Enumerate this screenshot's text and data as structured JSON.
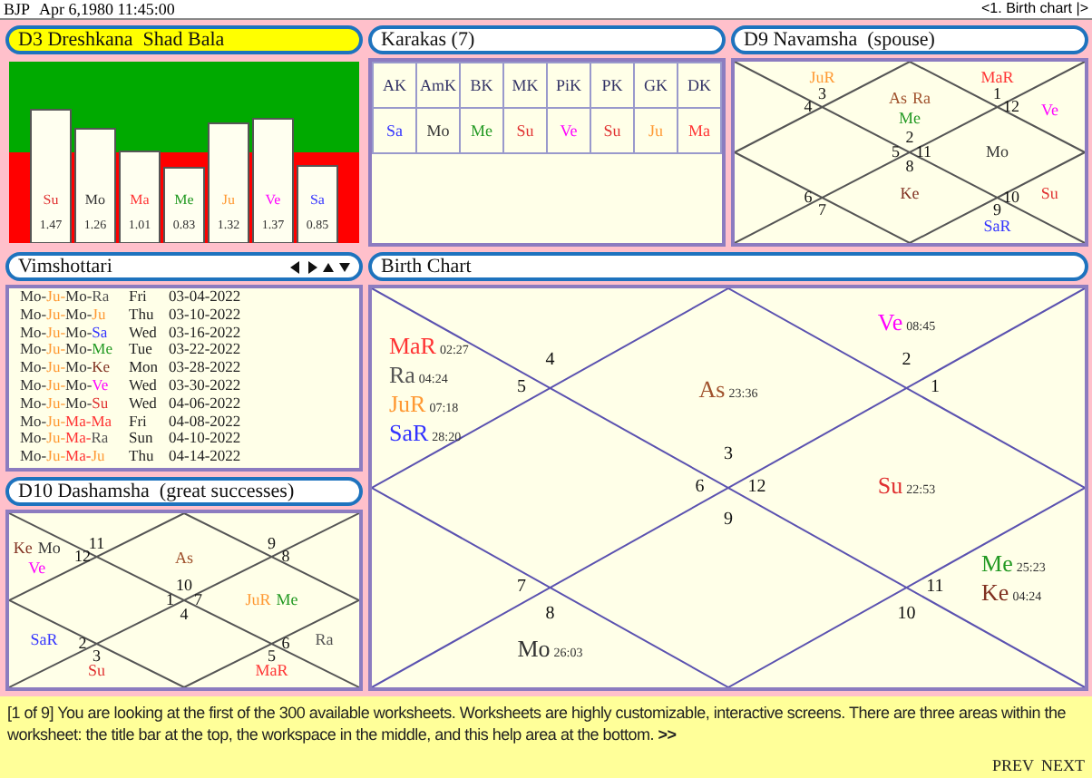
{
  "title_bar": {
    "chart_name": "BJP",
    "datetime": "Apr 6,1980 11:45:00",
    "worksheet": "<1. Birth chart |>"
  },
  "shad_bala": {
    "title": "D3 Dreshkana  Shad Bala",
    "bars": [
      {
        "planet": "Su",
        "color": "#e03030",
        "value": "1.47"
      },
      {
        "planet": "Mo",
        "color": "#333333",
        "value": "1.26"
      },
      {
        "planet": "Ma",
        "color": "#ff3333",
        "value": "1.01"
      },
      {
        "planet": "Me",
        "color": "#229922",
        "value": "0.83"
      },
      {
        "planet": "Ju",
        "color": "#ff9933",
        "value": "1.32"
      },
      {
        "planet": "Ve",
        "color": "#ff00ff",
        "value": "1.37"
      },
      {
        "planet": "Sa",
        "color": "#3333ff",
        "value": "0.85"
      }
    ]
  },
  "karakas": {
    "title": "Karakas (7)",
    "columns": [
      "AK",
      "AmK",
      "BK",
      "MK",
      "PiK",
      "PK",
      "GK",
      "DK"
    ],
    "values": [
      {
        "text": "Sa",
        "color": "#3333ff"
      },
      {
        "text": "Mo",
        "color": "#333333"
      },
      {
        "text": "Me",
        "color": "#229922"
      },
      {
        "text": "Su",
        "color": "#e03030"
      },
      {
        "text": "Ve",
        "color": "#ff00ff"
      },
      {
        "text": "Su",
        "color": "#e03030"
      },
      {
        "text": "Ju",
        "color": "#ff9933"
      },
      {
        "text": "Ma",
        "color": "#ff3333"
      }
    ]
  },
  "navamsha": {
    "title": "D9 Navamsha  (spouse)",
    "houses": [
      {
        "number": "2",
        "lines": [
          [
            {
              "name": "As",
              "color": "#a0522d"
            },
            {
              "name": "Ra",
              "color": "#a0522d"
            }
          ],
          [
            {
              "name": "Me",
              "color": "#229922"
            }
          ]
        ]
      },
      {
        "number": "3",
        "lines": [
          [
            {
              "name": "JuR",
              "color": "#ff9933"
            }
          ]
        ]
      },
      {
        "number": "4"
      },
      {
        "number": "5"
      },
      {
        "number": "6"
      },
      {
        "number": "7"
      },
      {
        "number": "8",
        "lines": [
          [
            {
              "name": "Ke",
              "color": "#803020"
            }
          ]
        ]
      },
      {
        "number": "9",
        "lines": [
          [
            {
              "name": "SaR",
              "color": "#3333ff"
            }
          ]
        ]
      },
      {
        "number": "10",
        "lines": [
          [
            {
              "name": "Su",
              "color": "#e03030"
            }
          ]
        ]
      },
      {
        "number": "11",
        "lines": [
          [
            {
              "name": "Mo",
              "color": "#333333"
            }
          ]
        ]
      },
      {
        "number": "12",
        "lines": [
          [
            {
              "name": "Ve",
              "color": "#ff00ff"
            }
          ]
        ]
      },
      {
        "number": "1",
        "lines": [
          [
            {
              "name": "MaR",
              "color": "#ff3333"
            }
          ]
        ]
      }
    ]
  },
  "vimshottari": {
    "title": "Vimshottari",
    "rows": [
      {
        "parts": [
          {
            "text": "Mo-",
            "color": "#333333"
          },
          {
            "text": "Ju-",
            "color": "#ff9933"
          },
          {
            "text": "Mo-",
            "color": "#333333"
          },
          {
            "text": "Ra",
            "color": "#555555"
          }
        ],
        "day": "Fri",
        "date": "03-04-2022"
      },
      {
        "parts": [
          {
            "text": "Mo-",
            "color": "#333333"
          },
          {
            "text": "Ju-",
            "color": "#ff9933"
          },
          {
            "text": "Mo-",
            "color": "#333333"
          },
          {
            "text": "Ju",
            "color": "#ff9933"
          }
        ],
        "day": "Thu",
        "date": "03-10-2022"
      },
      {
        "parts": [
          {
            "text": "Mo-",
            "color": "#333333"
          },
          {
            "text": "Ju-",
            "color": "#ff9933"
          },
          {
            "text": "Mo-",
            "color": "#333333"
          },
          {
            "text": "Sa",
            "color": "#3333ff"
          }
        ],
        "day": "Wed",
        "date": "03-16-2022"
      },
      {
        "parts": [
          {
            "text": "Mo-",
            "color": "#333333"
          },
          {
            "text": "Ju-",
            "color": "#ff9933"
          },
          {
            "text": "Mo-",
            "color": "#333333"
          },
          {
            "text": "Me",
            "color": "#229922"
          }
        ],
        "day": "Tue",
        "date": "03-22-2022"
      },
      {
        "parts": [
          {
            "text": "Mo-",
            "color": "#333333"
          },
          {
            "text": "Ju-",
            "color": "#ff9933"
          },
          {
            "text": "Mo-",
            "color": "#333333"
          },
          {
            "text": "Ke",
            "color": "#803020"
          }
        ],
        "day": "Mon",
        "date": "03-28-2022"
      },
      {
        "parts": [
          {
            "text": "Mo-",
            "color": "#333333"
          },
          {
            "text": "Ju-",
            "color": "#ff9933"
          },
          {
            "text": "Mo-",
            "color": "#333333"
          },
          {
            "text": "Ve",
            "color": "#ff00ff"
          }
        ],
        "day": "Wed",
        "date": "03-30-2022"
      },
      {
        "parts": [
          {
            "text": "Mo-",
            "color": "#333333"
          },
          {
            "text": "Ju-",
            "color": "#ff9933"
          },
          {
            "text": "Mo-",
            "color": "#333333"
          },
          {
            "text": "Su",
            "color": "#e03030"
          }
        ],
        "day": "Wed",
        "date": "04-06-2022"
      },
      {
        "parts": [
          {
            "text": "Mo-",
            "color": "#333333"
          },
          {
            "text": "Ju-",
            "color": "#ff9933"
          },
          {
            "text": "Ma-",
            "color": "#ff3333"
          },
          {
            "text": "Ma",
            "color": "#ff3333"
          }
        ],
        "day": "Fri",
        "date": "04-08-2022"
      },
      {
        "parts": [
          {
            "text": "Mo-",
            "color": "#333333"
          },
          {
            "text": "Ju-",
            "color": "#ff9933"
          },
          {
            "text": "Ma-",
            "color": "#ff3333"
          },
          {
            "text": "Ra",
            "color": "#555555"
          }
        ],
        "day": "Sun",
        "date": "04-10-2022"
      },
      {
        "parts": [
          {
            "text": "Mo-",
            "color": "#333333"
          },
          {
            "text": "Ju-",
            "color": "#ff9933"
          },
          {
            "text": "Ma-",
            "color": "#ff3333"
          },
          {
            "text": "Ju",
            "color": "#ff9933"
          }
        ],
        "day": "Thu",
        "date": "04-14-2022"
      }
    ]
  },
  "dashamsha": {
    "title": "D10 Dashamsha  (great successes)",
    "houses": [
      {
        "number": "10",
        "lines": [
          [
            {
              "name": "As",
              "color": "#a0522d"
            }
          ]
        ]
      },
      {
        "number": "11"
      },
      {
        "number": "12",
        "lines": [
          [
            {
              "name": "Ke",
              "color": "#803020"
            },
            {
              "name": "Mo",
              "color": "#333333"
            }
          ],
          [
            {
              "name": "Ve",
              "color": "#ff00ff"
            }
          ]
        ]
      },
      {
        "number": "1"
      },
      {
        "number": "2",
        "lines": [
          [
            {
              "name": "SaR",
              "color": "#3333ff"
            }
          ]
        ]
      },
      {
        "number": "3",
        "lines": [
          [
            {
              "name": "Su",
              "color": "#e03030"
            }
          ]
        ]
      },
      {
        "number": "4"
      },
      {
        "number": "5",
        "lines": [
          [
            {
              "name": "MaR",
              "color": "#ff3333"
            }
          ]
        ]
      },
      {
        "number": "6",
        "lines": [
          [
            {
              "name": "Ra",
              "color": "#555555"
            }
          ]
        ]
      },
      {
        "number": "7",
        "lines": [
          [
            {
              "name": "JuR",
              "color": "#ff9933"
            },
            {
              "name": "Me",
              "color": "#229922"
            }
          ]
        ]
      },
      {
        "number": "8"
      },
      {
        "number": "9"
      }
    ]
  },
  "birth_chart": {
    "title": "Birth Chart",
    "houses": [
      {
        "number": "3",
        "lines": [
          [
            {
              "name": "As",
              "degree": "23:36",
              "color": "#a0522d"
            }
          ]
        ]
      },
      {
        "number": "4"
      },
      {
        "number": "5",
        "lines": [
          [
            {
              "name": "MaR",
              "degree": "02:27",
              "color": "#ff3333"
            }
          ],
          [
            {
              "name": "Ra",
              "degree": "04:24",
              "color": "#555555"
            }
          ],
          [
            {
              "name": "JuR",
              "degree": "07:18",
              "color": "#ff9933"
            }
          ],
          [
            {
              "name": "SaR",
              "degree": "28:20",
              "color": "#3333ff"
            }
          ]
        ]
      },
      {
        "number": "6"
      },
      {
        "number": "7"
      },
      {
        "number": "8",
        "lines": [
          [
            {
              "name": "Mo",
              "degree": "26:03",
              "color": "#333333"
            }
          ]
        ]
      },
      {
        "number": "9"
      },
      {
        "number": "10"
      },
      {
        "number": "11",
        "lines": [
          [
            {
              "name": "Me",
              "degree": "25:23",
              "color": "#229922"
            }
          ],
          [
            {
              "name": "Ke",
              "degree": "04:24",
              "color": "#803020"
            }
          ]
        ]
      },
      {
        "number": "12",
        "lines": [
          [
            {
              "name": "Su",
              "degree": "22:53",
              "color": "#e03030"
            }
          ]
        ]
      },
      {
        "number": "1"
      },
      {
        "number": "2",
        "lines": [
          [
            {
              "name": "Ve",
              "degree": "08:45",
              "color": "#ff00ff"
            }
          ]
        ]
      }
    ]
  },
  "help": {
    "text": "[1 of 9] You are looking at the first of the 300 available worksheets. Worksheets are highly customizable, interactive screens. There are three areas within the worksheet: the title bar at the top, the workspace in the middle, and this help area at the bottom.",
    "more_link": ">>",
    "buttons": [
      "PREV",
      "NEXT"
    ]
  }
}
